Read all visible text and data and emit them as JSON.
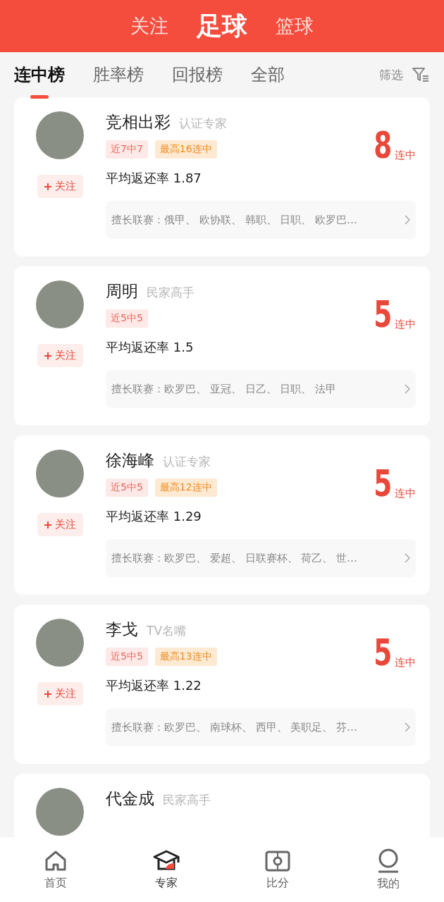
{
  "top_tabs": [
    {
      "label": "关注",
      "selected": false
    },
    {
      "label": "足球",
      "selected": true
    },
    {
      "label": "篮球",
      "selected": false
    }
  ],
  "rank_tabs": [
    {
      "label": "连中榜",
      "selected": true
    },
    {
      "label": "胜率榜",
      "selected": false
    },
    {
      "label": "回报榜",
      "selected": false
    },
    {
      "label": "全部",
      "selected": false
    }
  ],
  "filter": {
    "label": "筛选"
  },
  "experts": [
    {
      "name": "竞相出彩",
      "title": "认证专家",
      "tags": [
        {
          "kind": "recent",
          "label": "近7中7"
        },
        {
          "kind": "best",
          "label": "最高16连中"
        }
      ],
      "follow": "关注",
      "return_rate": "平均返还率 1.87",
      "leagues": "擅长联赛：俄甲、 欧协联、 韩职、 日职、 欧罗巴…",
      "streak": "8",
      "streak_unit": "连中"
    },
    {
      "name": "周明",
      "title": "民家高手",
      "tags": [
        {
          "kind": "recent",
          "label": "近5中5"
        }
      ],
      "follow": "关注",
      "return_rate": "平均返还率 1.5",
      "leagues": "擅长联赛：欧罗巴、 亚冠、 日乙、 日职、 法甲",
      "streak": "5",
      "streak_unit": "连中"
    },
    {
      "name": "徐海峰",
      "title": "认证专家",
      "tags": [
        {
          "kind": "recent",
          "label": "近5中5"
        },
        {
          "kind": "best",
          "label": "最高12连中"
        }
      ],
      "follow": "关注",
      "return_rate": "平均返还率 1.29",
      "leagues": "擅长联赛：欧罗巴、 爱超、 日联赛杯、 荷乙、 世…",
      "streak": "5",
      "streak_unit": "连中"
    },
    {
      "name": "李戈",
      "title": "TV名嘴",
      "tags": [
        {
          "kind": "recent",
          "label": "近5中5"
        },
        {
          "kind": "best",
          "label": "最高13连中"
        }
      ],
      "follow": "关注",
      "return_rate": "平均返还率 1.22",
      "leagues": "擅长联赛：欧罗巴、 南球杯、 西甲、 美职足、 芬…",
      "streak": "5",
      "streak_unit": "连中"
    },
    {
      "name": "代金成",
      "title": "民家高手"
    }
  ],
  "nav": [
    {
      "kind": "home",
      "label": "首页",
      "selected": false
    },
    {
      "kind": "experts",
      "label": "专家",
      "selected": true
    },
    {
      "kind": "scores",
      "label": "比分",
      "selected": false
    },
    {
      "kind": "profile",
      "label": "我的",
      "selected": false
    }
  ]
}
